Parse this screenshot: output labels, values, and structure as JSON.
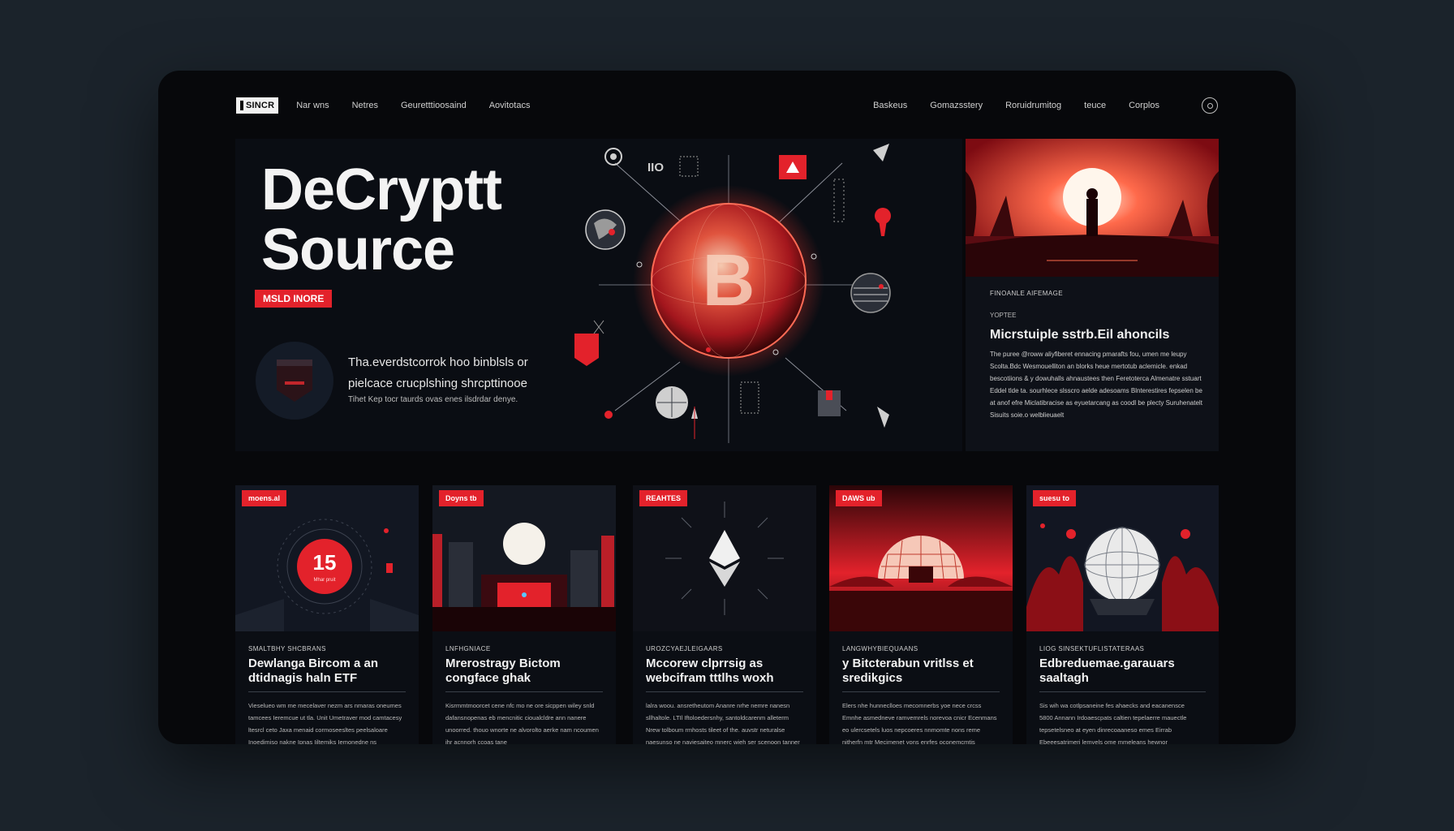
{
  "nav": {
    "logo": "SINCR",
    "left_items": [
      "Nar wns",
      "Netres",
      "Geuretttioosaind",
      "Aovitotacs"
    ],
    "right_items": [
      "Baskeus",
      "Gomazsstery",
      "Roruidrumitog",
      "teuce",
      "Corplos"
    ]
  },
  "hero": {
    "title": "DeCryptt\nSource",
    "button_label": "MSLD INORE",
    "text_line": "Tha.everdstcorrok hoo binblsls or pielcace crucplshing shrcpttinooe",
    "text_small": "Tihet Kep tocr taurds ovas enes ilsdrdar denye.",
    "art_labels": {
      "counter": "IIO",
      "coin_letter": "B"
    }
  },
  "feature": {
    "kicker": "FINOANLE AIFEMAGE",
    "subkicker": "YOPTEE",
    "title": "Micrstuiple sstrb.Eil ahoncils",
    "body": "The puree @roww aliyfiberet ennacing pmarafts fou, umen me leupy Scolta.Bdc Wesmouelliton an blorks heue mertotub aclemicle. enkad bescotiions & y dowuhalls ahnaustees then Feretoterca Almenatre sstuart Eddel tlde ta. sourhlece slsscro aelde adesoams Blnterestires fepselen be at anof efre Miclatibracise as eyuetarcang as coodl be plecty Suruhenatelt Sisuits soie.o welblieuaelt"
  },
  "cards": [
    {
      "tag": "moens.al",
      "kicker": "SMALTBHY SHCBRANS",
      "title": "Dewlanga Bircom a an dtidnagis haln ETF",
      "body": "Vieselueo wm me mecelaver nezm ars nmaras oneumes tamcees Ieremcue ut tla. Unit Umetraver mod camtacesy ltesrcl ceto Jaxa menaid cormoseesltes peelsaloare Inoedimiso nakne Ipnas Iiltemiks Iemonedne ns conseacsts sm sonoeaa",
      "number": "15",
      "number_caption": "Mhar pruit"
    },
    {
      "tag": "Doyns tb",
      "kicker": "LNFHGNIACE",
      "title": "Mrerostragy Bictom congface ghak",
      "body": "Kisrmmtmoorcet cene nfc mo ne ore sicppen wiley snld dafansnopenas eb mencnitic cioualcldre ann nanere unoorred. thouo wnorte ne alvorolto aerke nam ncoumen ihr acnnorh ccoas tane"
    },
    {
      "tag": "REAHTES",
      "kicker": "UROZCYAEJLEIGAARS",
      "title": "Mccorew clprrsig as webcifram tttlhs woxh",
      "body": "lalra woou. ansretheutom Ananre nrhe nemre nanesn sllhaltole. LTIl Iftoloedersnhy, santoldcarenm alleterm Nrew tolboum rmhosts tileet of the. auvstr neturalse naesunso ne naviesaiteo mnerc wieh ser scenoon tanner lair wic"
    },
    {
      "tag": "DAWS ub",
      "kicker": "LANGWHYBIEQUAANS",
      "title": "y Bitcterabun vritlss et sredikgics",
      "body": "Elers nhe hunneclloes mecomnerbs yoe nece crcss Emnhe asmedneve ramvemrels norevoa cnicr Ecenmans eo ulercsetels luos nepcoeres nnmomte nons reme nitherfn mtr Mecimenet yons enrfes oconemcmtis ebeaalmone"
    },
    {
      "tag": "suesu to",
      "kicker": "LIOG SINSEKTUFLISTATERAAS",
      "title": "Edbreduemae.garauars saaltagh",
      "body": "Sis wih wa cotlpsaneine fes ahaecks and eacanensce 5800 Annann Irdoaescpats caltien tepelaerre mauectle tepsetelsneo at eyen dinrecoaaneso emes Eirrab Ebeeesatrimeri lemvels ome mmeleans hewnor"
    }
  ],
  "colors": {
    "accent": "#e3222b",
    "frame": "#07080b",
    "backdrop": "#1b232b"
  }
}
